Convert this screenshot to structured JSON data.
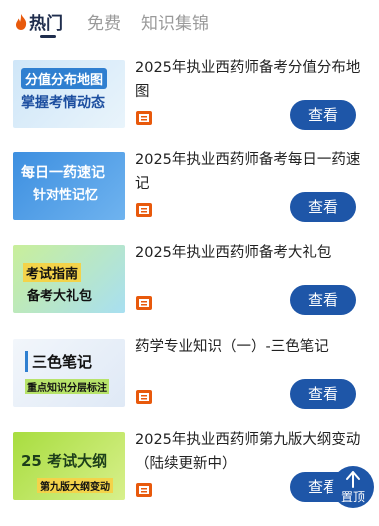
{
  "tabs": [
    {
      "label": "热门",
      "active": true
    },
    {
      "label": "免费",
      "active": false
    },
    {
      "label": "知识集锦",
      "active": false
    }
  ],
  "items": [
    {
      "title": "2025年执业西药师备考分值分布地图",
      "thumb_line1": "分值分布地图",
      "thumb_line2": "掌握考情动态",
      "button": "查看"
    },
    {
      "title": "2025年执业西药师备考每日一药速记",
      "thumb_line1": "每日一药速记",
      "thumb_line2": "针对性记忆",
      "button": "查看"
    },
    {
      "title": "2025年执业西药师备考大礼包",
      "thumb_line1": "考试指南",
      "thumb_line2": "备考大礼包",
      "button": "查看"
    },
    {
      "title": "药学专业知识（一）-三色笔记",
      "thumb_line1": "三色笔记",
      "thumb_line2": "重点知识分层标注",
      "button": "查看"
    },
    {
      "title": "2025年执业西药师第九版大纲变动（陆续更新中）",
      "thumb_line1": "25 考试大纲",
      "thumb_line2": "第九版大纲变动",
      "button": "查看"
    }
  ],
  "back_to_top": "置顶",
  "colors": {
    "accent": "#1e56a8",
    "icon_orange": "#e8590c",
    "tab_active": "#1f2d4d"
  }
}
